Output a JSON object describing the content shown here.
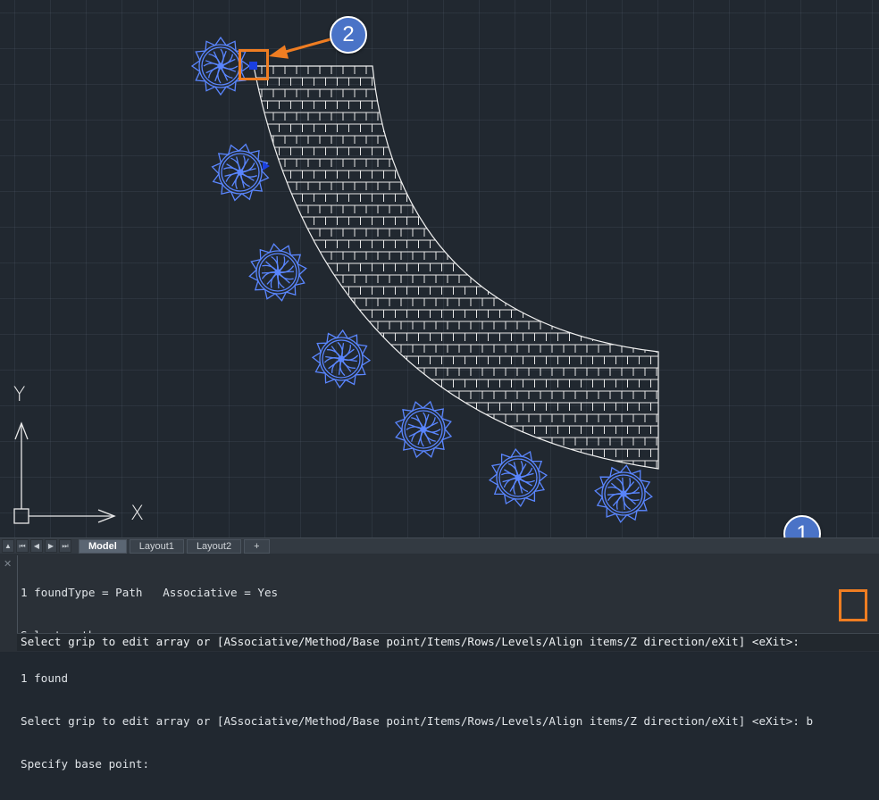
{
  "viewport": {
    "axis_labels": {
      "y": "Y",
      "x": "X"
    }
  },
  "callouts": [
    "2",
    "1"
  ],
  "tabs": {
    "items": [
      {
        "label": "Model",
        "active": true
      },
      {
        "label": "Layout1",
        "active": false
      },
      {
        "label": "Layout2",
        "active": false
      },
      {
        "label": "+",
        "active": false
      }
    ]
  },
  "command_line": {
    "history": [
      "1 foundType = Path   Associative = Yes",
      "Select path curve:",
      "1 found",
      "Select grip to edit array or [ASsociative/Method/Base point/Items/Rows/Levels/Align items/Z direction/eXit] <eXit>:",
      "Specify base point:"
    ],
    "typed_response": "b",
    "current_prompt": "Select grip to edit array or [ASsociative/Method/Base point/Items/Rows/Levels/Align items/Z direction/eXit] <eXit>:"
  },
  "colors": {
    "canvas": "#212830",
    "hatch": "#e6e6e6",
    "array_item": "#5a86ff",
    "grip": "#1a3fe0",
    "callout": "#4a73c7",
    "highlight": "#ef7d22"
  }
}
